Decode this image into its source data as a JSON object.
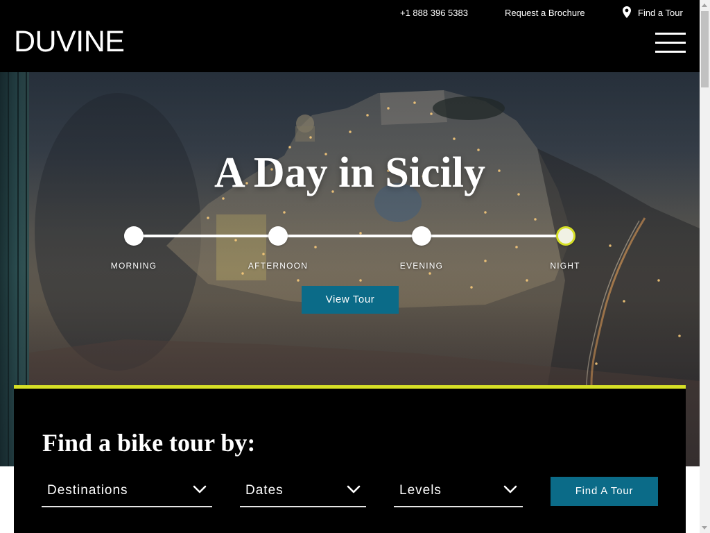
{
  "header": {
    "logo": "DUVINE",
    "phone": "+1 888 396 5383",
    "brochure_link": "Request a Brochure",
    "find_tour_link": "Find a Tour",
    "find_tour_icon": "map-pin-icon",
    "menu_icon": "hamburger-menu-icon"
  },
  "hero": {
    "title": "A Day in Sicily",
    "timeline": [
      {
        "label": "MORNING",
        "active": false
      },
      {
        "label": "AFTERNOON",
        "active": false
      },
      {
        "label": "EVENING",
        "active": false
      },
      {
        "label": "NIGHT",
        "active": true
      }
    ],
    "cta_label": "View Tour"
  },
  "search": {
    "heading": "Find a bike tour by:",
    "filters": [
      {
        "label": "Destinations",
        "icon": "chevron-down-icon"
      },
      {
        "label": "Dates",
        "icon": "chevron-down-icon"
      },
      {
        "label": "Levels",
        "icon": "chevron-down-icon"
      }
    ],
    "submit_label": "Find A Tour"
  },
  "colors": {
    "header_bg": "#000000",
    "accent": "#d6df26",
    "button": "#0b6b88",
    "panel_bg": "#000000"
  }
}
